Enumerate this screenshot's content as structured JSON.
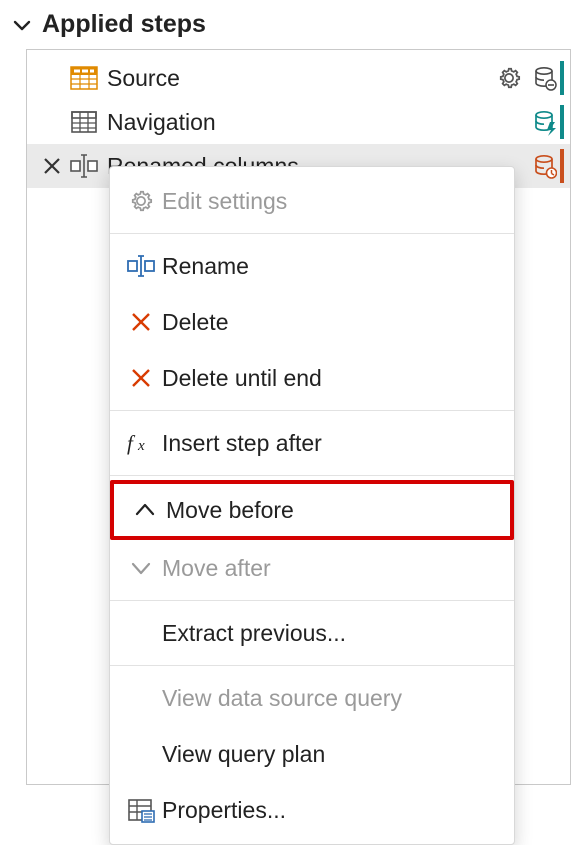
{
  "section": {
    "title": "Applied steps"
  },
  "steps": [
    {
      "label": "Source"
    },
    {
      "label": "Navigation"
    },
    {
      "label": "Renamed columns"
    }
  ],
  "context_menu": {
    "edit_settings": "Edit settings",
    "rename": "Rename",
    "delete": "Delete",
    "delete_until_end": "Delete until end",
    "insert_step_after": "Insert step after",
    "move_before": "Move before",
    "move_after": "Move after",
    "extract_previous": "Extract previous...",
    "view_data_source_query": "View data source query",
    "view_query_plan": "View query plan",
    "properties": "Properties..."
  }
}
